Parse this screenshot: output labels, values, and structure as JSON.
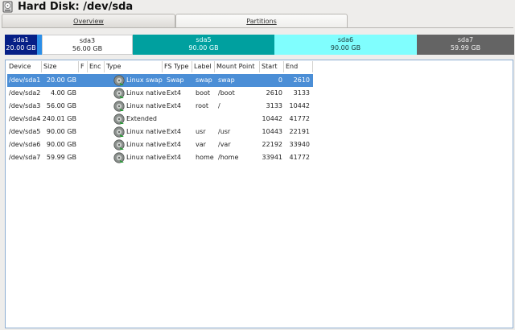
{
  "window": {
    "title": "Hard Disk: /dev/sda"
  },
  "tabs": [
    {
      "label": "Overview"
    },
    {
      "label": "Partitions"
    }
  ],
  "partition_map": [
    {
      "name": "sda1",
      "size": "20.00 GB"
    },
    {
      "name": "sda3",
      "size": "56.00 GB"
    },
    {
      "name": "sda5",
      "size": "90.00 GB"
    },
    {
      "name": "sda6",
      "size": "90.00 GB"
    },
    {
      "name": "sda7",
      "size": "59.99 GB"
    }
  ],
  "table": {
    "columns": [
      "Device",
      "Size",
      "F",
      "Enc",
      "Type",
      "FS Type",
      "Label",
      "Mount Point",
      "Start",
      "End"
    ],
    "rows": [
      {
        "device": "/dev/sda1",
        "size": "20.00 GB",
        "type": "Linux swap",
        "fstype": "Swap",
        "label": "swap",
        "mount": "swap",
        "start": "0",
        "end": "2610"
      },
      {
        "device": "/dev/sda2",
        "size": "4.00 GB",
        "type": "Linux native",
        "fstype": "Ext4",
        "label": "boot",
        "mount": "/boot",
        "start": "2610",
        "end": "3133"
      },
      {
        "device": "/dev/sda3",
        "size": "56.00 GB",
        "type": "Linux native",
        "fstype": "Ext4",
        "label": "root",
        "mount": "/",
        "start": "3133",
        "end": "10442"
      },
      {
        "device": "/dev/sda4",
        "size": "240.01 GB",
        "type": "Extended",
        "fstype": "",
        "label": "",
        "mount": "",
        "start": "10442",
        "end": "41772"
      },
      {
        "device": "/dev/sda5",
        "size": "90.00 GB",
        "type": "Linux native",
        "fstype": "Ext4",
        "label": "usr",
        "mount": "/usr",
        "start": "10443",
        "end": "22191"
      },
      {
        "device": "/dev/sda6",
        "size": "90.00 GB",
        "type": "Linux native",
        "fstype": "Ext4",
        "label": "var",
        "mount": "/var",
        "start": "22192",
        "end": "33940"
      },
      {
        "device": "/dev/sda7",
        "size": "59.99 GB",
        "type": "Linux native",
        "fstype": "Ext4",
        "label": "home",
        "mount": "/home",
        "start": "33941",
        "end": "41772"
      }
    ],
    "selected_row": 0
  },
  "icons": {
    "title": "hard-disk-icon",
    "row": "disk-partition-icon"
  },
  "colors": {
    "selection": "#4b8ed6",
    "sda1": "#061f86",
    "sda5": "#00a09f",
    "sda6": "#80fefe",
    "sda7": "#646464"
  }
}
